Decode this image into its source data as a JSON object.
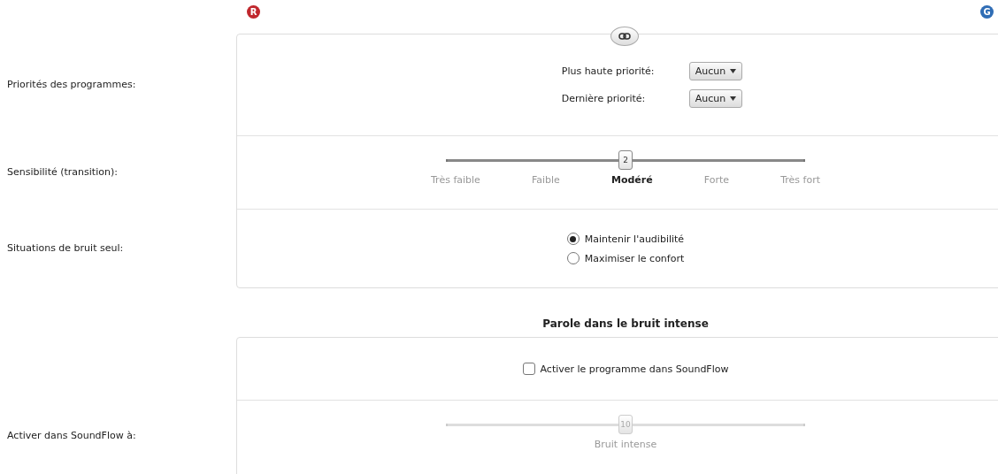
{
  "ear_badges": [
    {
      "label": "R",
      "color": "#c0272d"
    },
    {
      "label": "G",
      "color": "#2f6db5"
    }
  ],
  "program_priorities": {
    "label": "Priorités des programmes:",
    "rows": [
      {
        "label": "Plus haute priorité:",
        "value": "Aucun"
      },
      {
        "label": "Dernière priorité:",
        "value": "Aucun"
      }
    ]
  },
  "sensitivity": {
    "label": "Sensibilité (transition):",
    "thumb": "2",
    "level": 0.5,
    "steps": [
      {
        "label": "Très faible",
        "selected": false
      },
      {
        "label": "Faible",
        "selected": false
      },
      {
        "label": "Modéré",
        "selected": true
      },
      {
        "label": "Forte",
        "selected": false
      },
      {
        "label": "Très fort",
        "selected": false
      }
    ]
  },
  "noise_only": {
    "label": "Situations de bruit seul:",
    "options": [
      {
        "label": "Maintenir l'audibilité",
        "selected": true
      },
      {
        "label": "Maximiser le confort",
        "selected": false
      }
    ]
  },
  "speech_in_noise": {
    "title": "Parole dans le bruit intense",
    "checkbox": {
      "label": "Activer le programme dans SoundFlow",
      "checked": false
    },
    "soundflow": {
      "label": "Activer dans SoundFlow à:",
      "thumb": "10",
      "level": 0.5,
      "disabled": true,
      "caption": "Bruit intense"
    }
  }
}
